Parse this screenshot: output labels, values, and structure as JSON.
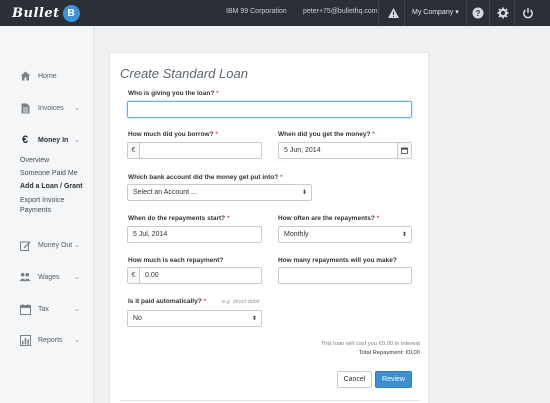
{
  "topbar": {
    "logo_text": "Bullet",
    "logo_badge": "B",
    "company": "IBM 99 Corporation",
    "email": "peter+75@bullethq.com",
    "my_company": "My Company",
    "my_company_caret": "▾"
  },
  "sidebar": {
    "items": [
      {
        "label": "Home",
        "icon": "home-icon"
      },
      {
        "label": "Invoices",
        "icon": "document-icon"
      },
      {
        "label": "Money In",
        "icon": "euro-icon"
      },
      {
        "label": "Money Out",
        "icon": "edit-icon"
      },
      {
        "label": "Wages",
        "icon": "people-icon"
      },
      {
        "label": "Tax",
        "icon": "calendar-icon"
      },
      {
        "label": "Reports",
        "icon": "chart-icon"
      }
    ],
    "chevron": "⌄",
    "money_in_sub": [
      "Overview",
      "Someone Paid Me",
      "Add a Loan / Grant",
      "Export Invoice Payments"
    ]
  },
  "form": {
    "title": "Create Standard Loan",
    "lender_label": "Who is giving you the loan?",
    "lender_value": "",
    "borrowed_label": "How much did you borrow?",
    "borrowed_currency": "€",
    "borrowed_value": "",
    "received_label": "When did you get the money?",
    "received_value": "5 Jun, 2014",
    "account_label": "Which bank account did the money get put into?",
    "account_value": "Select an Account ...",
    "repay_start_label": "When do the repayments start?",
    "repay_start_value": "5 Jul, 2014",
    "frequency_label": "How often are the repayments?",
    "frequency_value": "Monthly",
    "repayment_label": "How much is each repayment?",
    "repayment_currency": "€",
    "repayment_value": "0.00",
    "count_label": "How many repayments will you make?",
    "count_value": "",
    "auto_label": "Is it paid automatically?",
    "auto_hint": "e.g. direct debit",
    "auto_value": "No",
    "required_mark": "*",
    "select_caret": "⬍",
    "cost_note": "This loan will cost you €0.00 in interest",
    "total_repayment": "Total Repayment: €0.00",
    "cancel_label": "Cancel",
    "review_label": "Review"
  }
}
